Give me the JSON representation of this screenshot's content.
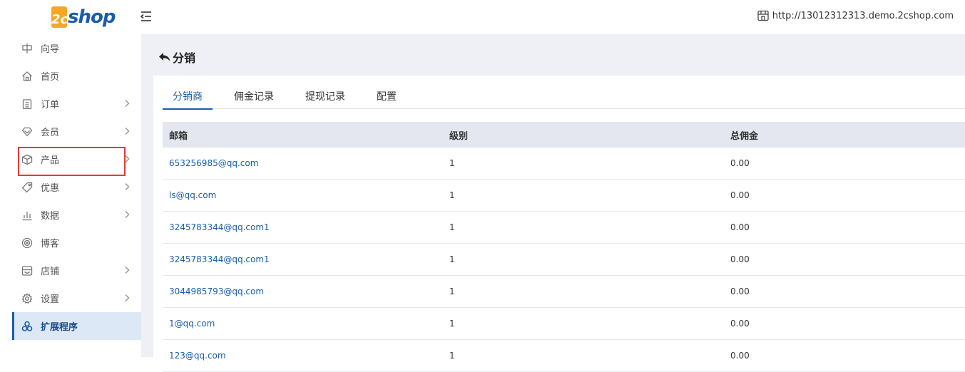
{
  "header": {
    "logo_badge": "2c",
    "logo_text": "shop",
    "site_url": "http://13012312313.demo.2cshop.com"
  },
  "sidebar": {
    "items": [
      {
        "label": "向导",
        "icon": "guide-icon",
        "has_children": false,
        "active": false
      },
      {
        "label": "首页",
        "icon": "home-icon",
        "has_children": false,
        "active": false
      },
      {
        "label": "订单",
        "icon": "order-icon",
        "has_children": true,
        "active": false
      },
      {
        "label": "会员",
        "icon": "member-icon",
        "has_children": true,
        "active": false
      },
      {
        "label": "产品",
        "icon": "product-icon",
        "has_children": true,
        "active": false
      },
      {
        "label": "优惠",
        "icon": "discount-icon",
        "has_children": true,
        "active": false
      },
      {
        "label": "数据",
        "icon": "data-icon",
        "has_children": true,
        "active": false
      },
      {
        "label": "博客",
        "icon": "blog-icon",
        "has_children": false,
        "active": false
      },
      {
        "label": "店铺",
        "icon": "store-icon",
        "has_children": true,
        "active": false
      },
      {
        "label": "设置",
        "icon": "settings-icon",
        "has_children": true,
        "active": false
      },
      {
        "label": "扩展程序",
        "icon": "extensions-icon",
        "has_children": false,
        "active": true
      }
    ]
  },
  "page": {
    "title": "分销"
  },
  "tabs": [
    {
      "label": "分销商",
      "active": true
    },
    {
      "label": "佣金记录",
      "active": false
    },
    {
      "label": "提现记录",
      "active": false
    },
    {
      "label": "配置",
      "active": false
    }
  ],
  "table": {
    "columns": [
      "邮箱",
      "级别",
      "总佣金"
    ],
    "rows": [
      {
        "email": "653256985@qq.com",
        "level": "1",
        "commission": "0.00"
      },
      {
        "email": "ls@qq.com",
        "level": "1",
        "commission": "0.00"
      },
      {
        "email": "3245783344@qq.com1",
        "level": "1",
        "commission": "0.00"
      },
      {
        "email": "3245783344@qq.com1",
        "level": "1",
        "commission": "0.00"
      },
      {
        "email": "3044985793@qq.com",
        "level": "1",
        "commission": "0.00"
      },
      {
        "email": "1@qq.com",
        "level": "1",
        "commission": "0.00"
      },
      {
        "email": "123@qq.com",
        "level": "1",
        "commission": "0.00"
      }
    ]
  },
  "colors": {
    "accent": "#1a5da8",
    "highlight": "#e53935",
    "active_bg": "#dce8f5"
  }
}
